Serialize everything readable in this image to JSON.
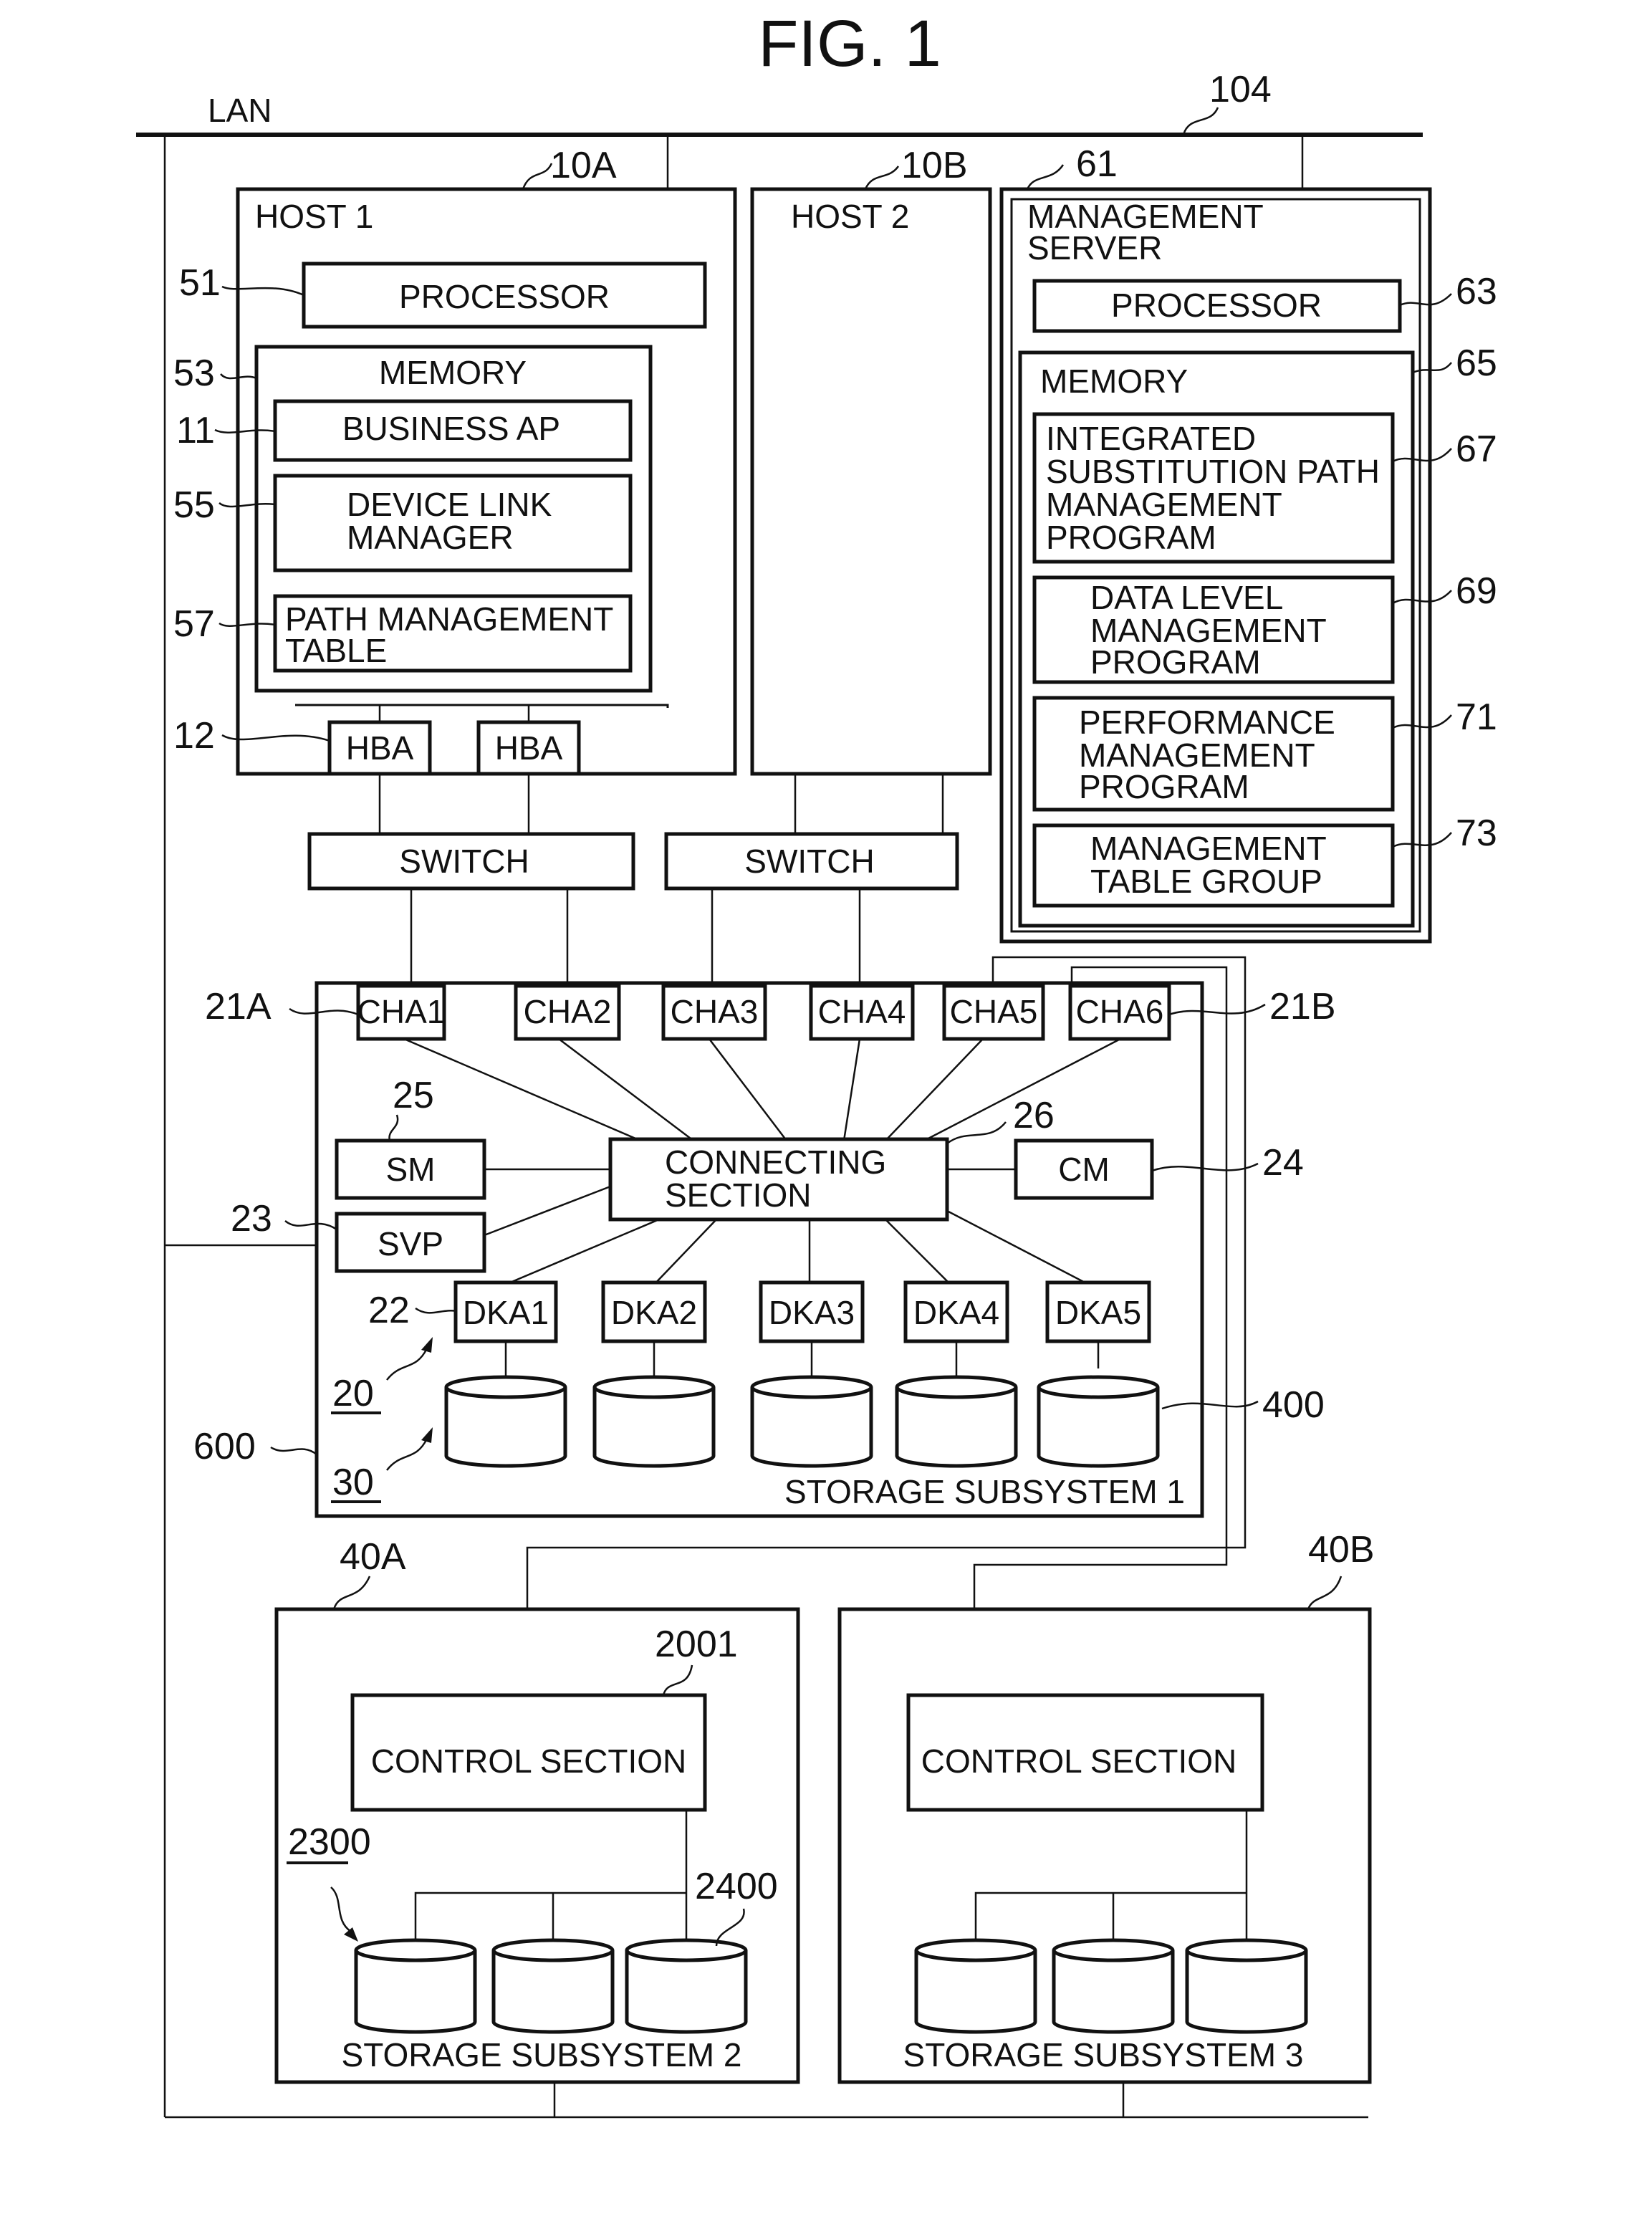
{
  "figure": {
    "title": "FIG. 1",
    "lan_label": "LAN",
    "lan_ref": "104"
  },
  "host1": {
    "ref": "10A",
    "label": "HOST 1",
    "processor": {
      "ref": "51",
      "label": "PROCESSOR"
    },
    "memory": {
      "ref": "53",
      "label": "MEMORY"
    },
    "business_ap": {
      "ref": "11",
      "label": "BUSINESS AP"
    },
    "device_link_manager": {
      "ref": "55",
      "lines": [
        "DEVICE LINK",
        "MANAGER"
      ]
    },
    "path_management_table": {
      "ref": "57",
      "lines": [
        "PATH MANAGEMENT",
        "TABLE"
      ]
    },
    "hba": {
      "ref": "12",
      "labels": [
        "HBA",
        "HBA"
      ]
    }
  },
  "host2": {
    "ref": "10B",
    "label": "HOST 2"
  },
  "switches": [
    "SWITCH",
    "SWITCH"
  ],
  "management_server": {
    "ref": "61",
    "lines": [
      "MANAGEMENT",
      "SERVER"
    ],
    "processor": {
      "ref": "63",
      "label": "PROCESSOR"
    },
    "memory": {
      "ref": "65",
      "label": "MEMORY"
    },
    "programs": [
      {
        "ref": "67",
        "lines": [
          "INTEGRATED",
          "SUBSTITUTION PATH",
          "MANAGEMENT",
          "PROGRAM"
        ]
      },
      {
        "ref": "69",
        "lines": [
          "DATA LEVEL",
          "MANAGEMENT",
          "PROGRAM"
        ]
      },
      {
        "ref": "71",
        "lines": [
          "PERFORMANCE",
          "MANAGEMENT",
          "PROGRAM"
        ]
      },
      {
        "ref": "73",
        "lines": [
          "MANAGEMENT",
          "TABLE GROUP"
        ]
      }
    ]
  },
  "storage1": {
    "ref": "600",
    "label": "STORAGE SUBSYSTEM 1",
    "cha_ref_left": "21A",
    "cha_ref_right": "21B",
    "chas": [
      "CHA1",
      "CHA2",
      "CHA3",
      "CHA4",
      "CHA5",
      "CHA6"
    ],
    "sm": {
      "ref": "25",
      "label": "SM"
    },
    "svp": {
      "ref": "23",
      "label": "SVP"
    },
    "connecting_section": {
      "ref": "26",
      "lines": [
        "CONNECTING",
        "SECTION"
      ]
    },
    "cm": {
      "ref": "24",
      "label": "CM"
    },
    "dka_ref": "22",
    "dkas": [
      "DKA1",
      "DKA2",
      "DKA3",
      "DKA4",
      "DKA5"
    ],
    "disk_group_ref": "20",
    "disks_ref": "30",
    "volume_ref": "400"
  },
  "storage2": {
    "ref": "40A",
    "label": "STORAGE SUBSYSTEM 2",
    "control": {
      "ref": "2001",
      "label": "CONTROL SECTION"
    },
    "disk_group_ref": "2300",
    "volume_ref": "2400"
  },
  "storage3": {
    "ref": "40B",
    "label": "STORAGE SUBSYSTEM 3",
    "control": {
      "label": "CONTROL SECTION"
    }
  }
}
